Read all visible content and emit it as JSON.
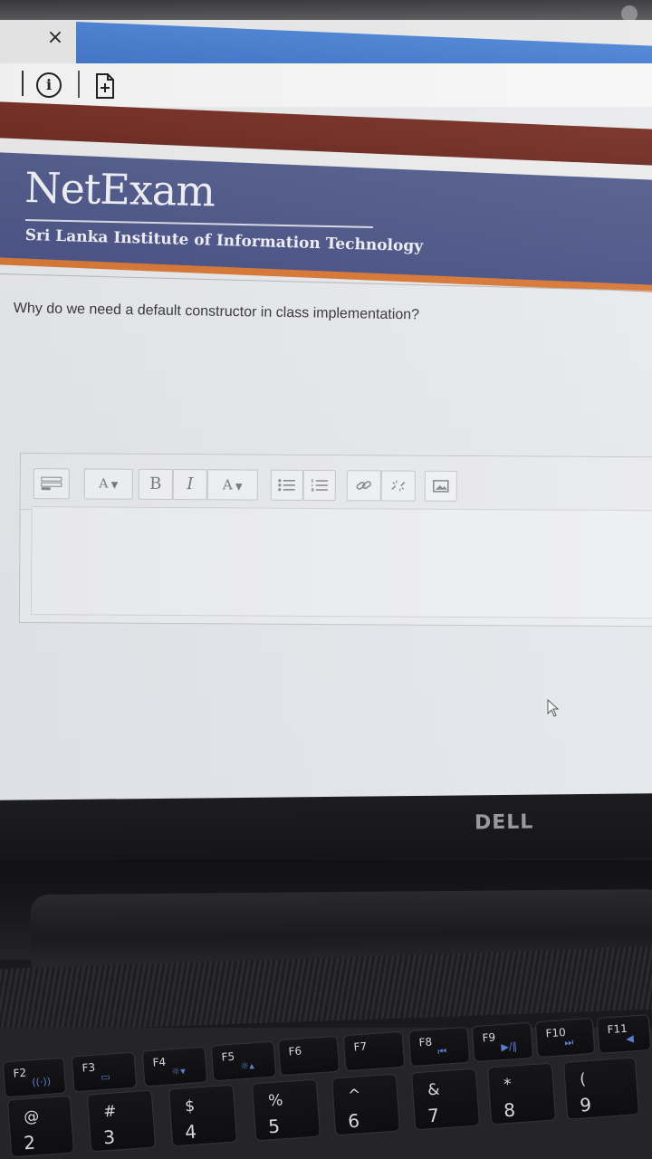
{
  "browser": {
    "tab_close_glyph": "×",
    "info_glyph": "i"
  },
  "header": {
    "brand": "NetExam",
    "subtitle": "Sri Lanka Institute of Information Technology",
    "banner_color": "#4f5889",
    "accent_color": "#d97a3a"
  },
  "question": {
    "text": "Why do we need a default constructor in class implementation?"
  },
  "editor": {
    "toolbar": {
      "buttons": [
        {
          "name": "toolbar-toggle-icon"
        },
        {
          "name": "paragraph-style-icon",
          "label": "A"
        },
        {
          "name": "bold-icon",
          "label": "B"
        },
        {
          "name": "italic-icon",
          "label": "I"
        },
        {
          "name": "font-color-icon",
          "label": "A"
        },
        {
          "name": "unordered-list-icon"
        },
        {
          "name": "ordered-list-icon"
        },
        {
          "name": "link-icon"
        },
        {
          "name": "unlink-icon"
        },
        {
          "name": "image-icon"
        }
      ]
    },
    "value": ""
  },
  "laptop": {
    "brand": "DELL",
    "function_keys": [
      "F2",
      "F3",
      "F4",
      "F5",
      "F6",
      "F7",
      "F8",
      "F9",
      "F10",
      "F11"
    ],
    "number_keys": [
      {
        "top": "@",
        "bottom": "2"
      },
      {
        "top": "#",
        "bottom": "3"
      },
      {
        "top": "$",
        "bottom": "4"
      },
      {
        "top": "%",
        "bottom": "5"
      },
      {
        "top": "^",
        "bottom": "6"
      },
      {
        "top": "&",
        "bottom": "7"
      },
      {
        "top": "*",
        "bottom": "8"
      },
      {
        "top": "(",
        "bottom": "9"
      }
    ]
  }
}
